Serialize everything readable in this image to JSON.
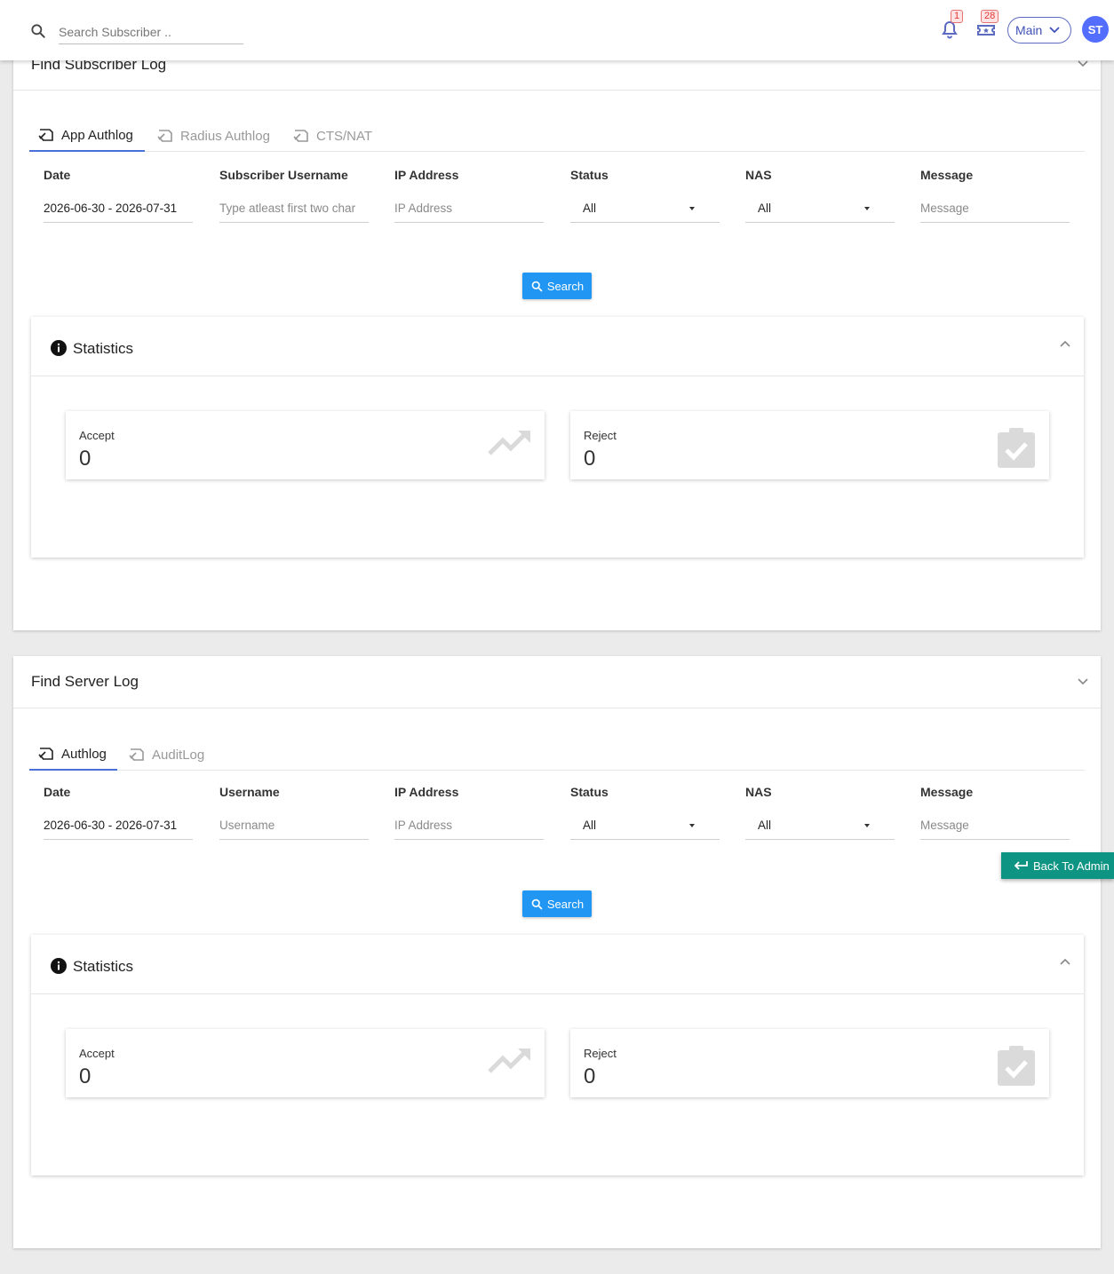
{
  "topbar": {
    "search_placeholder": "Search Subscriber ..",
    "notifications_badge": "1",
    "tickets_badge": "28",
    "context_select": "Main",
    "avatar_initials": "ST"
  },
  "subscriber_log": {
    "title": "Find Subscriber Log",
    "tabs": [
      "App Authlog",
      "Radius Authlog",
      "CTS/NAT"
    ],
    "filters": {
      "date_label": "Date",
      "date_value": "2026-06-30 - 2026-07-31",
      "username_label": "Subscriber Username",
      "username_placeholder": "Type atleast first two char",
      "ip_label": "IP Address",
      "ip_placeholder": "IP Address",
      "status_label": "Status",
      "status_value": "All",
      "nas_label": "NAS",
      "nas_value": "All",
      "message_label": "Message",
      "message_placeholder": "Message"
    },
    "search_label": "Search",
    "statistics": {
      "title": "Statistics",
      "accept_label": "Accept",
      "accept_value": "0",
      "reject_label": "Reject",
      "reject_value": "0"
    }
  },
  "server_log": {
    "title": "Find Server Log",
    "tabs": [
      "Authlog",
      "AuditLog"
    ],
    "filters": {
      "date_label": "Date",
      "date_value": "2026-06-30 - 2026-07-31",
      "username_label": "Username",
      "username_placeholder": "Username",
      "ip_label": "IP Address",
      "ip_placeholder": "IP Address",
      "status_label": "Status",
      "status_value": "All",
      "nas_label": "NAS",
      "nas_value": "All",
      "message_label": "Message",
      "message_placeholder": "Message"
    },
    "search_label": "Search",
    "statistics": {
      "title": "Statistics",
      "accept_label": "Accept",
      "accept_value": "0",
      "reject_label": "Reject",
      "reject_value": "0"
    }
  },
  "back_to_admin_label": "Back To Admin",
  "colors": {
    "primary_button": "#2196f3",
    "back_button": "#0e9482",
    "avatar": "#536dfe",
    "badge_text": "#e53935",
    "active_tab_underline": "#4a6fd8"
  },
  "icons": {
    "search": "search-icon",
    "notifications": "bell-icon",
    "tickets": "ticket-icon",
    "tab": "log-icon",
    "info": "info-icon",
    "accept": "trending-up-icon",
    "reject": "clipboard-check-icon",
    "back": "return-arrow-icon"
  }
}
